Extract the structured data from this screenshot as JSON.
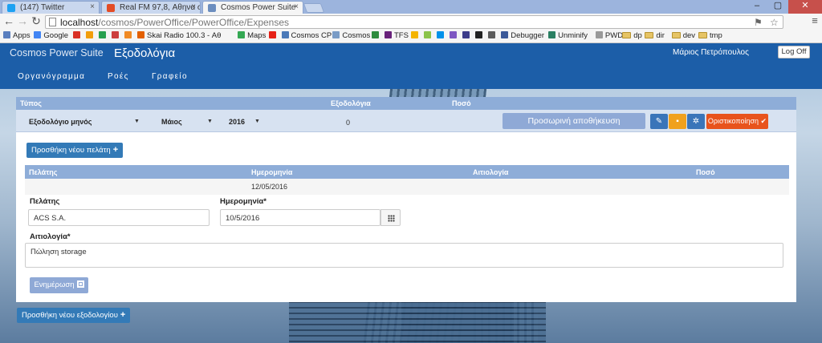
{
  "browser": {
    "tabs": [
      {
        "label": "(147) Twitter",
        "color": "#1da1f2"
      },
      {
        "label": "Real FM 97,8, Αθηνα σ",
        "color": "#e34c26"
      },
      {
        "label": "Cosmos Power Suite",
        "color": "#6c8ebf"
      }
    ],
    "url_host": "localhost",
    "url_path": "/cosmos/PowerOffice/PowerOffice/Expenses",
    "bookmarks": [
      {
        "label": "Apps",
        "icon": "apps-icon",
        "color": "#5a7fbf"
      },
      {
        "label": "Google",
        "icon": "google-icon",
        "color": "#4285f4"
      },
      {
        "label": "",
        "icon": "gmail-icon",
        "color": "#d93025"
      },
      {
        "label": "",
        "icon": "bookmark-icon-1",
        "color": "#f29e0c"
      },
      {
        "label": "",
        "icon": "bookmark-icon-2",
        "color": "#27a04f"
      },
      {
        "label": "",
        "icon": "bookmark-icon-3",
        "color": "#cc3f3f"
      },
      {
        "label": "",
        "icon": "rss-icon",
        "color": "#f08a24"
      },
      {
        "label": "Skai Radio 100.3 - Αθ",
        "icon": "skai-icon",
        "color": "#e36000"
      },
      {
        "label": "Maps",
        "icon": "maps-icon",
        "color": "#34a853"
      },
      {
        "label": "",
        "icon": "youtube-icon",
        "color": "#e62117"
      },
      {
        "label": "Cosmos CP",
        "icon": "globe-icon",
        "color": "#4a79b8"
      },
      {
        "label": "Cosmos",
        "icon": "page-icon",
        "color": "#7a9cc6"
      },
      {
        "label": "",
        "icon": "check-icon",
        "color": "#2e8b3e"
      },
      {
        "label": "TFS",
        "icon": "tfs-icon",
        "color": "#68217a"
      },
      {
        "label": "",
        "icon": "smiley-icon",
        "color": "#f4b400"
      },
      {
        "label": "",
        "icon": "bookmark-icon-4",
        "color": "#8bc34a"
      },
      {
        "label": "",
        "icon": "bookmark-icon-5",
        "color": "#0091ea"
      },
      {
        "label": "",
        "icon": "bookmark-icon-6",
        "color": "#7e57c2"
      },
      {
        "label": "",
        "icon": "bold-b-icon",
        "color": "#3c3c8a"
      },
      {
        "label": "",
        "icon": "camera-icon",
        "color": "#222222"
      },
      {
        "label": "",
        "icon": "bookmark-icon-7",
        "color": "#5b5b5b"
      },
      {
        "label": "Debugger",
        "icon": "facebook-icon",
        "color": "#3b5998"
      },
      {
        "label": "Unminify",
        "icon": "unminify-icon",
        "color": "#2a7f62"
      },
      {
        "label": "PWD",
        "icon": "page-icon-2",
        "color": "#999999"
      },
      {
        "label": "dp",
        "icon": "folder-icon",
        "color": "#e6c465"
      },
      {
        "label": "dir",
        "icon": "folder-icon",
        "color": "#e6c465"
      },
      {
        "label": "dev",
        "icon": "folder-icon",
        "color": "#e6c465"
      },
      {
        "label": "tmp",
        "icon": "folder-icon",
        "color": "#e6c465"
      }
    ]
  },
  "app": {
    "brand": "Cosmos Power Suite",
    "heading": "Εξοδολόγια",
    "user": "Μάριος Πετρόπουλος",
    "logoff": "Log Off",
    "nav": [
      "Οργανόγραμμα",
      "Ροές",
      "Γραφείο"
    ]
  },
  "expenses": {
    "headers": {
      "type": "Τύπος",
      "expense": "Εξοδολόγια",
      "amount": "Ποσό"
    },
    "type_value": "Εξοδολόγιο μηνός",
    "month_value": "Μάιος",
    "year_value": "2016",
    "total": "0",
    "temp_save_label": "Προσωρινή αποθήκευση",
    "finalize_label": "Οριστικοποίηση ✔",
    "colors": {
      "edit": "#3a75b9",
      "save": "#f0a11e",
      "settings": "#3a75b9",
      "finalize": "#e8531c"
    }
  },
  "customer": {
    "add_button": "Προσθήκη νέου πελάτη",
    "columns": [
      "Πελάτης",
      "Ημερομηνία",
      "Αιτιολογία",
      "Ποσό"
    ],
    "row_date": "12/05/2016",
    "labels": {
      "customer": "Πελάτης",
      "date": "Ημερομηνία*",
      "reason": "Αιτιολογία*"
    },
    "values": {
      "customer": "ACS S.A.",
      "date": "10/5/2016",
      "reason": "Πώληση storage"
    },
    "update_button": "Ενημέρωση"
  },
  "add_expense_button": "Προσθήκη νέου εξοδολογίου"
}
